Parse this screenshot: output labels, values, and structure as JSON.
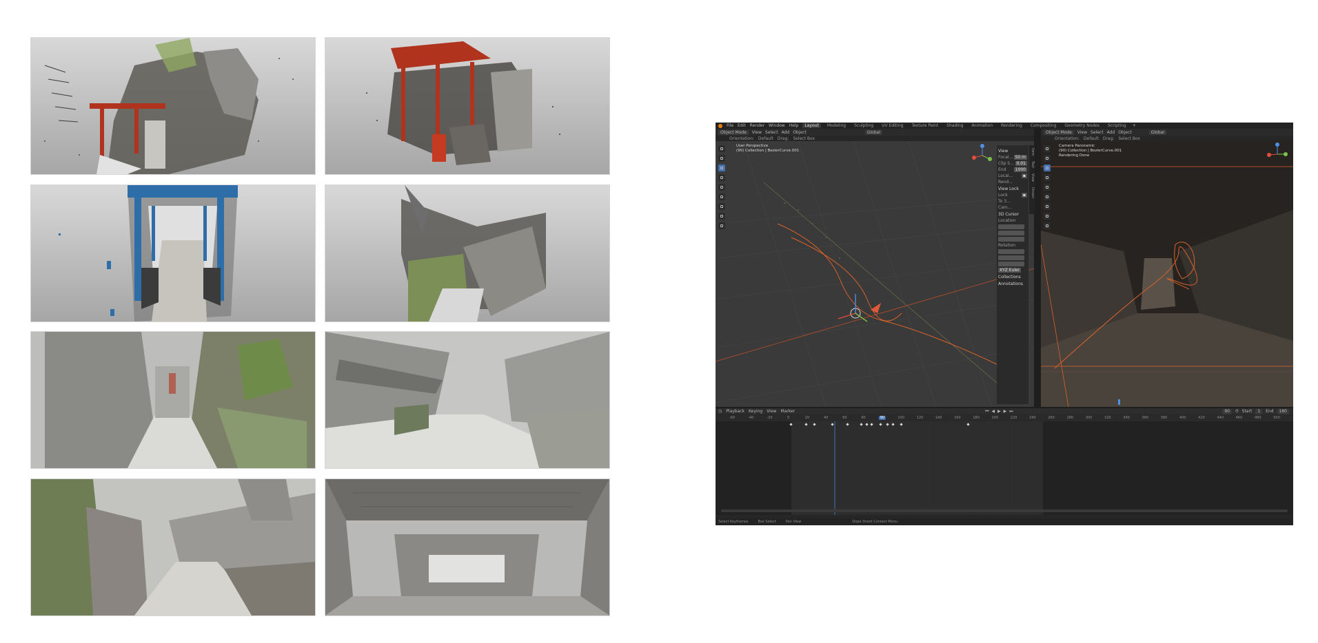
{
  "gallery": {
    "images": [
      {
        "name": "shrine-side-pointcloud"
      },
      {
        "name": "shrine-front-pointcloud"
      },
      {
        "name": "blue-corridor-pointcloud"
      },
      {
        "name": "ruined-house-pointcloud"
      },
      {
        "name": "narrow-alley-pointcloud"
      },
      {
        "name": "street-buildings-pointcloud"
      },
      {
        "name": "overgrown-path-pointcloud"
      },
      {
        "name": "tunnel-underpass-pointcloud"
      }
    ]
  },
  "blender": {
    "menu": [
      "File",
      "Edit",
      "Render",
      "Window",
      "Help"
    ],
    "workspaces": [
      "Layout",
      "Modeling",
      "Sculpting",
      "UV Editing",
      "Texture Paint",
      "Shading",
      "Animation",
      "Rendering",
      "Compositing",
      "Geometry Nodes",
      "Scripting"
    ],
    "left_header": {
      "mode": "Object Mode",
      "menu": [
        "View",
        "Select",
        "Add",
        "Object"
      ],
      "transform": "Global"
    },
    "left_subheader": {
      "orientation": "Orientation:",
      "default": "Default",
      "drag": "Drag:",
      "select": "Select Box"
    },
    "left_viewport": {
      "line1": "User Perspective",
      "line2": "(90) Collection | BezierCurve.001"
    },
    "right_header": {
      "mode": "Object Mode",
      "menu": [
        "View",
        "Select",
        "Add",
        "Object"
      ],
      "transform": "Global"
    },
    "right_subheader": {
      "orientation": "Orientation:",
      "default": "Default",
      "drag": "Drag:",
      "select": "Select Box"
    },
    "right_viewport": {
      "line1": "Camera Panoramic",
      "line2": "(90) Collection | BezierCurve.001",
      "line3": "Rendering Done"
    },
    "npanel": {
      "view_title": "View",
      "focal": "Focal...",
      "focal_val": "50 m",
      "clip_s": "Clip S...",
      "clip_s_val": "0.01",
      "end": "End",
      "end_val": "1000",
      "local": "Local...",
      "rend": "Rend...",
      "view_lock": "View Lock",
      "lock": "Lock",
      "to_3d": "To 3...",
      "cam": "Cam...",
      "cursor_title": "3D Cursor",
      "location": "Location",
      "rotation": "Rotation",
      "xyz_euler": "XYZ Euler",
      "collections": "Collections",
      "annotations": "Annotations",
      "tabs": [
        "Item",
        "Tool",
        "View",
        "Onsen"
      ]
    },
    "timeline": {
      "menu": [
        "Playback",
        "Keying",
        "View",
        "Marker"
      ],
      "current_frame": "90",
      "start_label": "Start",
      "start": "1",
      "end_label": "End",
      "end": "180",
      "ticks": [
        "-60",
        "-40",
        "-20",
        "0",
        "20",
        "40",
        "60",
        "80",
        "90",
        "100",
        "120",
        "140",
        "160",
        "180",
        "200",
        "220",
        "240",
        "260",
        "280",
        "300",
        "320",
        "340",
        "360",
        "380",
        "400",
        "420",
        "440",
        "460",
        "480",
        "500"
      ]
    },
    "statusbar": [
      "Select Keyframes",
      "Box Select",
      "Pan View",
      "Dope Sheet Context Menu"
    ]
  }
}
